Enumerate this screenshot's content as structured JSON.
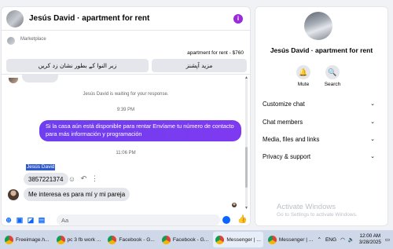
{
  "chat": {
    "title": "Jesús David · apartment for rent",
    "marketplace_label": "Marketplace",
    "listing_price": "apartment for rent - $760",
    "button_left": "زبر النوا کے بطور نشان زد کریں",
    "button_right": "مزید آپشنز",
    "waiting_text": "Jesús David is waiting for your response.",
    "time1": "9:39 PM",
    "sent_message": "Si la casa aún está disponible para rentar Envíame tu número de contacto para más información y programación",
    "time2": "11:06 PM",
    "sender_name": "Jesús David",
    "number_message": "3857221374",
    "received_message": "Me interesa es para mí y mi pareja",
    "composer_placeholder": "Aa"
  },
  "side": {
    "name": "Jesús David · apartment for rent",
    "mute_label": "Mute",
    "search_label": "Search",
    "sections": [
      "Customize chat",
      "Chat members",
      "Media, files and links",
      "Privacy & support"
    ],
    "watermark_title": "Activate Windows",
    "watermark_sub": "Go to Settings to activate Windows."
  },
  "taskbar": {
    "items": [
      "Freeimage.h...",
      "pc 3 fb work ...",
      "Facebook - G...",
      "Facebook - G...",
      "Messenger | ...",
      "Messenger | ..."
    ],
    "lang": "ENG",
    "time": "12:00 AM",
    "date": "3/28/2025"
  },
  "colors": {
    "accent": "#0866ff",
    "sent_bubble": "#6e3ff0",
    "info": "#9b2bd9"
  }
}
